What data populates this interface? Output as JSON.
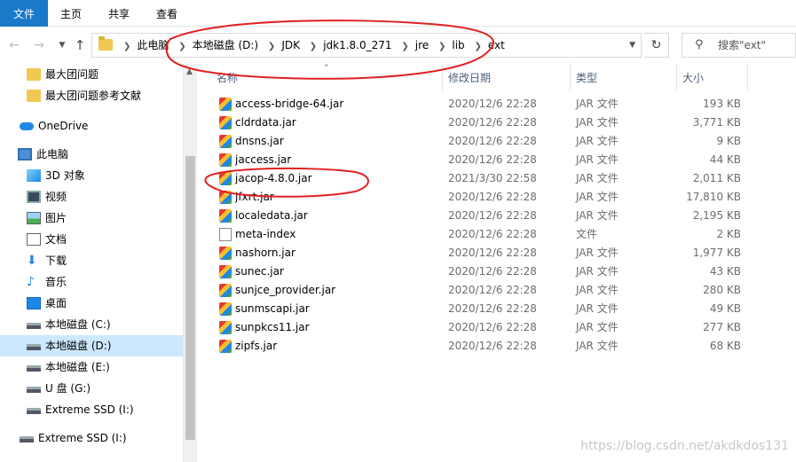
{
  "ribbon": {
    "tabs": [
      "文件",
      "主页",
      "共享",
      "查看"
    ]
  },
  "address": {
    "crumbs": [
      "此电脑",
      "本地磁盘 (D:)",
      "JDK",
      "jdk1.8.0_271",
      "jre",
      "lib",
      "ext"
    ]
  },
  "search": {
    "placeholder": "搜索\"ext\""
  },
  "nav": {
    "items": [
      {
        "label": "最大团问题",
        "icon": "folder-icon"
      },
      {
        "label": "最大团问题参考文献",
        "icon": "folder-icon"
      },
      {
        "label": "OneDrive",
        "icon": "cloud-icon"
      },
      {
        "label": "此电脑",
        "icon": "computer-icon"
      },
      {
        "label": "3D 对象",
        "icon": "cube-icon"
      },
      {
        "label": "视频",
        "icon": "film-icon"
      },
      {
        "label": "图片",
        "icon": "picture-icon"
      },
      {
        "label": "文档",
        "icon": "document-icon"
      },
      {
        "label": "下载",
        "icon": "download-icon"
      },
      {
        "label": "音乐",
        "icon": "music-icon"
      },
      {
        "label": "桌面",
        "icon": "desktop-icon"
      },
      {
        "label": "本地磁盘 (C:)",
        "icon": "drive-icon"
      },
      {
        "label": "本地磁盘 (D:)",
        "icon": "drive-icon",
        "selected": true
      },
      {
        "label": "本地磁盘 (E:)",
        "icon": "drive-icon"
      },
      {
        "label": "U 盘 (G:)",
        "icon": "drive-icon"
      },
      {
        "label": "Extreme SSD (I:)",
        "icon": "drive-icon"
      },
      {
        "label": "Extreme SSD (I:)",
        "icon": "drive-icon"
      }
    ]
  },
  "columns": {
    "name": "名称",
    "date": "修改日期",
    "type": "类型",
    "size": "大小"
  },
  "files": [
    {
      "name": "access-bridge-64.jar",
      "date": "2020/12/6 22:28",
      "type": "JAR 文件",
      "size": "193 KB",
      "kind": "jar"
    },
    {
      "name": "cldrdata.jar",
      "date": "2020/12/6 22:28",
      "type": "JAR 文件",
      "size": "3,771 KB",
      "kind": "jar"
    },
    {
      "name": "dnsns.jar",
      "date": "2020/12/6 22:28",
      "type": "JAR 文件",
      "size": "9 KB",
      "kind": "jar"
    },
    {
      "name": "jaccess.jar",
      "date": "2020/12/6 22:28",
      "type": "JAR 文件",
      "size": "44 KB",
      "kind": "jar"
    },
    {
      "name": "jacop-4.8.0.jar",
      "date": "2021/3/30 22:58",
      "type": "JAR 文件",
      "size": "2,011 KB",
      "kind": "jar"
    },
    {
      "name": "jfxrt.jar",
      "date": "2020/12/6 22:28",
      "type": "JAR 文件",
      "size": "17,810 KB",
      "kind": "jar"
    },
    {
      "name": "localedata.jar",
      "date": "2020/12/6 22:28",
      "type": "JAR 文件",
      "size": "2,195 KB",
      "kind": "jar"
    },
    {
      "name": "meta-index",
      "date": "2020/12/6 22:28",
      "type": "文件",
      "size": "2 KB",
      "kind": "plain"
    },
    {
      "name": "nashorn.jar",
      "date": "2020/12/6 22:28",
      "type": "JAR 文件",
      "size": "1,977 KB",
      "kind": "jar"
    },
    {
      "name": "sunec.jar",
      "date": "2020/12/6 22:28",
      "type": "JAR 文件",
      "size": "43 KB",
      "kind": "jar"
    },
    {
      "name": "sunjce_provider.jar",
      "date": "2020/12/6 22:28",
      "type": "JAR 文件",
      "size": "280 KB",
      "kind": "jar"
    },
    {
      "name": "sunmscapi.jar",
      "date": "2020/12/6 22:28",
      "type": "JAR 文件",
      "size": "49 KB",
      "kind": "jar"
    },
    {
      "name": "sunpkcs11.jar",
      "date": "2020/12/6 22:28",
      "type": "JAR 文件",
      "size": "277 KB",
      "kind": "jar"
    },
    {
      "name": "zipfs.jar",
      "date": "2020/12/6 22:28",
      "type": "JAR 文件",
      "size": "68 KB",
      "kind": "jar"
    }
  ],
  "watermark": "https://blog.csdn.net/akdkdos131",
  "colors": {
    "accent": "#1979ca",
    "selection": "#cce8ff",
    "annotation": "#e02020"
  }
}
